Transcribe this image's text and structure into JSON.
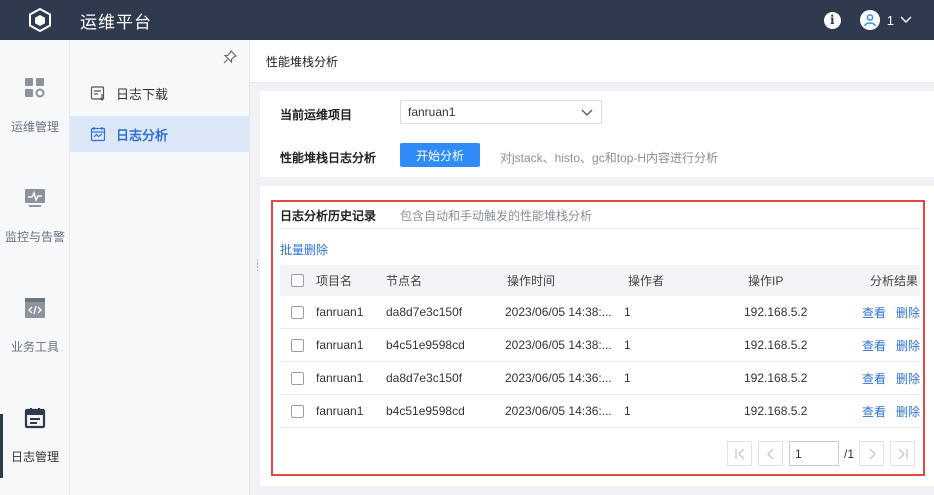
{
  "header": {
    "app_title": "运维平台",
    "user_name": "1"
  },
  "icon_nav": {
    "items": [
      {
        "label": "运维管理",
        "icon": "dashboard-grid-icon"
      },
      {
        "label": "监控与告警",
        "icon": "monitor-icon"
      },
      {
        "label": "业务工具",
        "icon": "code-window-icon"
      },
      {
        "label": "日志管理",
        "icon": "calendar-log-icon",
        "active": true
      }
    ]
  },
  "sub_nav": {
    "items": [
      {
        "label": "日志下载",
        "icon": "log-download-icon"
      },
      {
        "label": "日志分析",
        "icon": "log-analysis-icon",
        "active": true
      }
    ]
  },
  "page": {
    "title": "性能堆栈分析"
  },
  "form": {
    "project_label": "当前运维项目",
    "project_value": "fanruan1",
    "analysis_label": "性能堆栈日志分析",
    "start_button": "开始分析",
    "hint": "对jstack、histo、gc和top-H内容进行分析"
  },
  "history": {
    "title": "日志分析历史记录",
    "subtitle": "包含自动和手动触发的性能堆栈分析",
    "batch_delete": "批量删除",
    "columns": [
      "项目名",
      "节点名",
      "操作时间",
      "操作者",
      "操作IP",
      "分析结果"
    ],
    "rows": [
      {
        "project": "fanruan1",
        "node": "da8d7e3c150f",
        "time": "2023/06/05 14:38:...",
        "operator": "1",
        "ip": "192.168.5.2",
        "view": "查看",
        "delete": "删除"
      },
      {
        "project": "fanruan1",
        "node": "b4c51e9598cd",
        "time": "2023/06/05 14:38:...",
        "operator": "1",
        "ip": "192.168.5.2",
        "view": "查看",
        "delete": "删除"
      },
      {
        "project": "fanruan1",
        "node": "da8d7e3c150f",
        "time": "2023/06/05 14:36:...",
        "operator": "1",
        "ip": "192.168.5.2",
        "view": "查看",
        "delete": "删除"
      },
      {
        "project": "fanruan1",
        "node": "b4c51e9598cd",
        "time": "2023/06/05 14:36:...",
        "operator": "1",
        "ip": "192.168.5.2",
        "view": "查看",
        "delete": "删除"
      }
    ]
  },
  "pagination": {
    "current_page": "1",
    "total": "/1"
  },
  "colors": {
    "topbar": "#2f3a4f",
    "primary": "#2f8cf6",
    "link": "#2f72d6",
    "highlight_border": "#e04a3f",
    "active_sub_bg": "#dce7f7"
  }
}
